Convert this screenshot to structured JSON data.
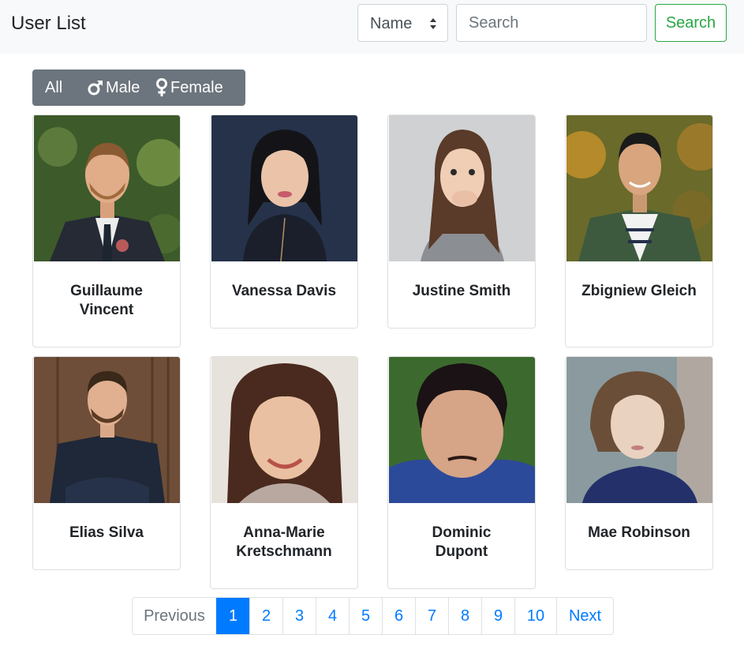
{
  "navbar": {
    "title": "User List",
    "sort_select": {
      "selected": "Name"
    },
    "search": {
      "placeholder": "Search",
      "button_label": "Search"
    }
  },
  "filter": {
    "all_label": "All",
    "male_label": "Male",
    "female_label": "Female"
  },
  "users": [
    {
      "name": "Guillaume Vincent"
    },
    {
      "name": "Vanessa Davis"
    },
    {
      "name": "Justine Smith"
    },
    {
      "name": "Zbigniew Gleich"
    },
    {
      "name": "Elias Silva"
    },
    {
      "name": "Anna-Marie Kretschmann"
    },
    {
      "name": "Dominic Dupont"
    },
    {
      "name": "Mae Robinson"
    }
  ],
  "pagination": {
    "previous": "Previous",
    "pages": [
      "1",
      "2",
      "3",
      "4",
      "5",
      "6",
      "7",
      "8",
      "9",
      "10"
    ],
    "active_page": "1",
    "next": "Next"
  },
  "colors": {
    "primary": "#007bff",
    "success": "#28a745",
    "secondary": "#6c757d",
    "navbar_bg": "#f8f9fa"
  }
}
